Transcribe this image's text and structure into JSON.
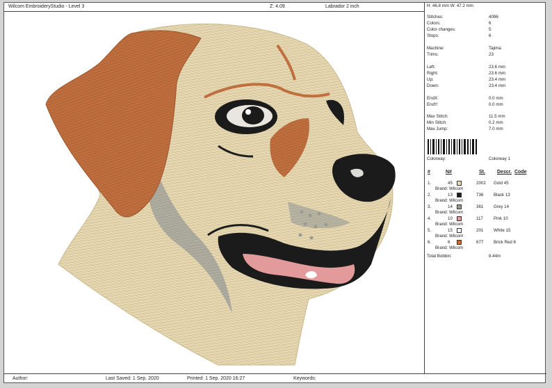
{
  "header": {
    "app_title": "Wilcom EmbroideryStudio - Level 3",
    "zoom": "Z: 4.09",
    "design_name": "Labrador 2 inch",
    "size": "H: 46.8 mm   W: 47.2 mm"
  },
  "stats": {
    "stitches_label": "Stitches:",
    "stitches": "4096",
    "colors_label": "Colors:",
    "colors": "6",
    "color_changes_label": "Color changes:",
    "color_changes": "5",
    "stops_label": "Stops:",
    "stops": "6",
    "machine_label": "Machine:",
    "machine": "Tajima",
    "trims_label": "Trims:",
    "trims": "23",
    "left_label": "Left:",
    "left": "23.6 mm",
    "right_label": "Right:",
    "right": "23.6 mm",
    "up_label": "Up:",
    "up": "23.4 mm",
    "down_label": "Down:",
    "down": "23.4 mm",
    "endx_label": "EndX:",
    "endx": "0.0 mm",
    "endy_label": "EndY:",
    "endy": "0.0 mm",
    "max_stitch_label": "Max Stitch:",
    "max_stitch": "11.5 mm",
    "min_stitch_label": "Min Stitch:",
    "min_stitch": "0.2 mm",
    "max_jump_label": "Max Jump:",
    "max_jump": "7.0 mm"
  },
  "colorway": {
    "label": "Colorway:",
    "value": "Colorway 1"
  },
  "table": {
    "headers": {
      "num": "#",
      "n": "N#",
      "st": "St.",
      "descr": "Descr.",
      "code": "Code"
    },
    "rows": [
      {
        "num": "1.",
        "n": "45",
        "st": "2002",
        "descr": "Gold 45",
        "brand": "Brand: Wilcom",
        "color": "#e9d9b4"
      },
      {
        "num": "2.",
        "n": "13",
        "st": "736",
        "descr": "Black 13",
        "brand": "Brand: Wilcom",
        "color": "#1b1b1b"
      },
      {
        "num": "3.",
        "n": "14",
        "st": "361",
        "descr": "Grey 14",
        "brand": "Brand: Wilcom",
        "color": "#9a9a92"
      },
      {
        "num": "4.",
        "n": "10",
        "st": "117",
        "descr": "Pink 10",
        "brand": "Brand: Wilcom",
        "color": "#e39a9a"
      },
      {
        "num": "5.",
        "n": "15",
        "st": "201",
        "descr": "White 15",
        "brand": "Brand: Wilcom",
        "color": "#ffffff"
      },
      {
        "num": "6.",
        "n": "6",
        "st": "677",
        "descr": "Brick Red 6",
        "brand": "Brand: Wilcom",
        "color": "#c0703f"
      }
    ],
    "total_label": "Total Bobbin:",
    "total_value": "8.44m"
  },
  "footer": {
    "author": "Author:",
    "last_saved": "Last Saved:  1 Sep. 2020",
    "printed": "Printed:  1 Sep. 2020 16:27",
    "keywords": "Keywords:"
  },
  "colors": {
    "thread_gold": "#e6d8b2",
    "thread_brick": "#c0703f",
    "thread_black": "#1b1b1b",
    "thread_grey": "#9a9a92",
    "thread_pink": "#e39a9a"
  }
}
